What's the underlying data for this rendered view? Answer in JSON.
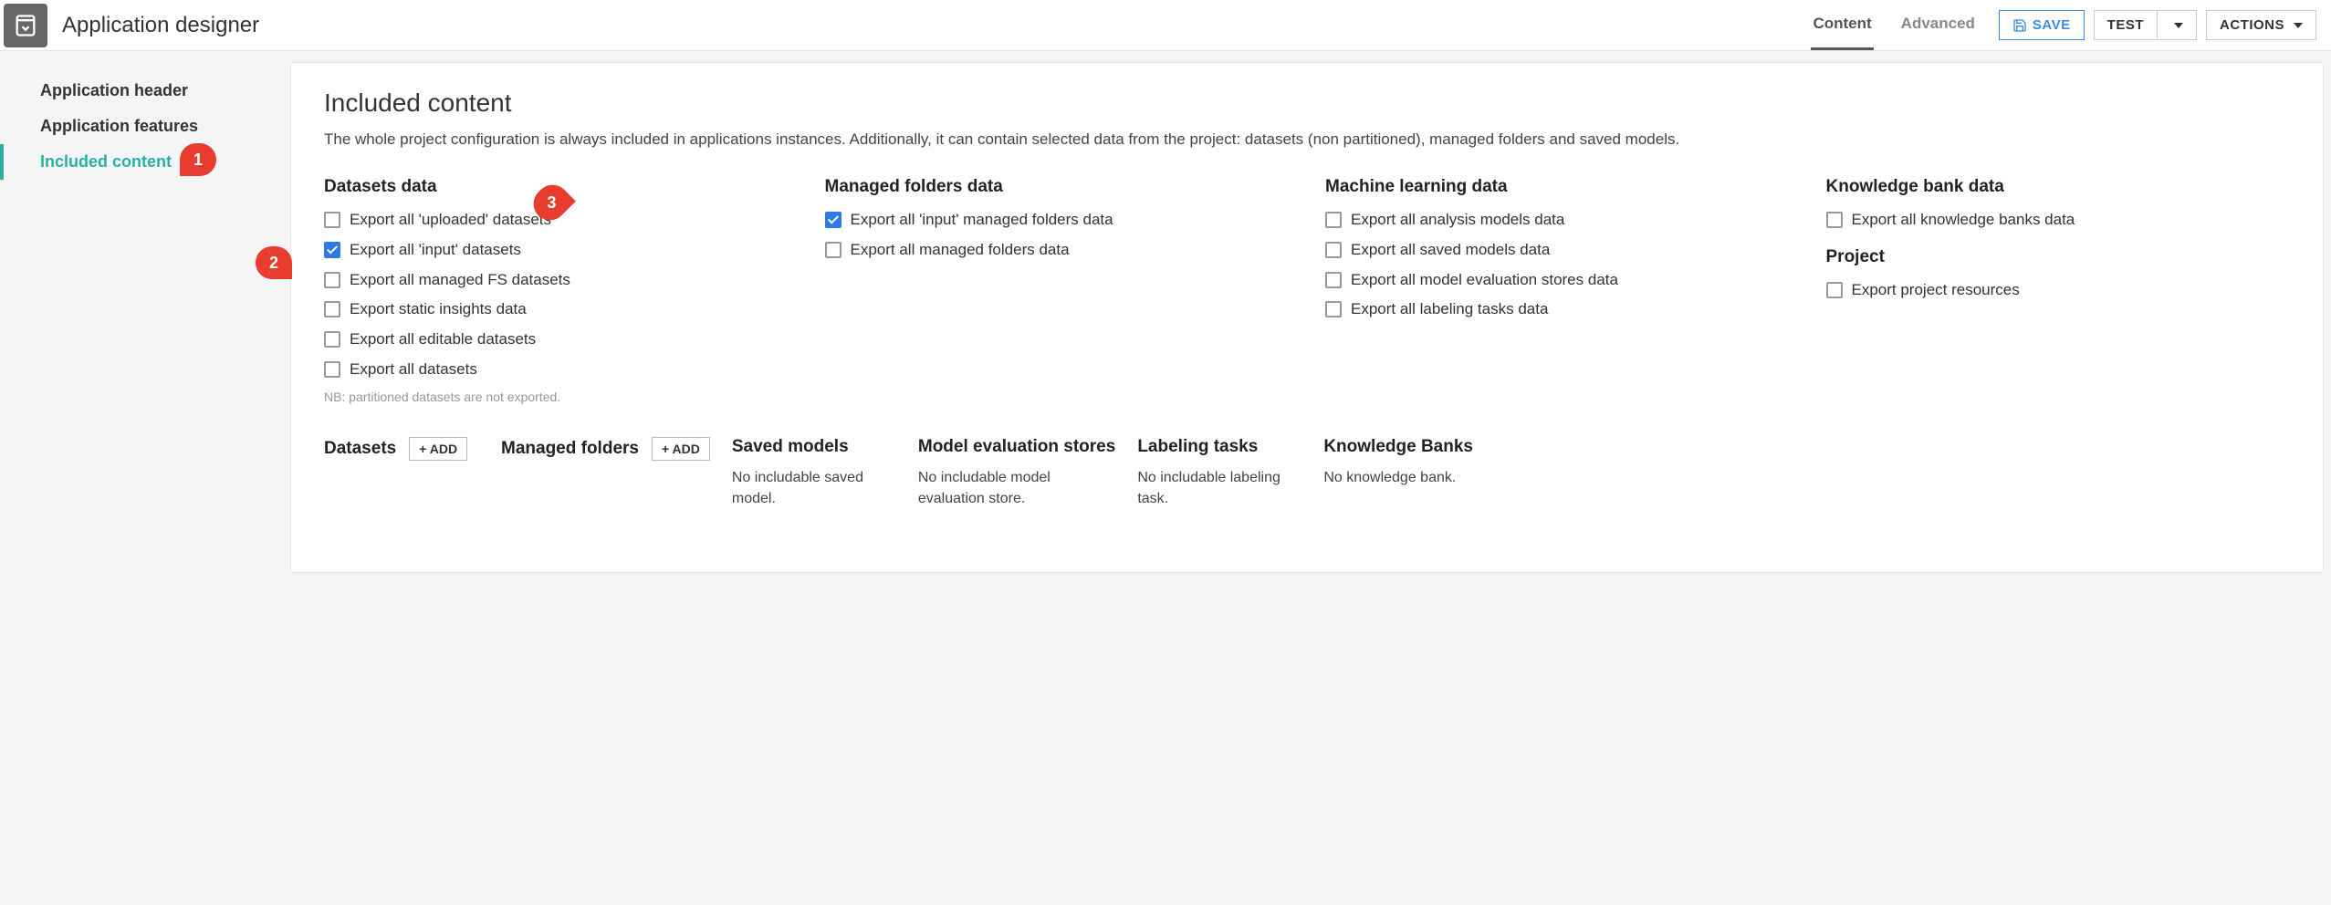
{
  "header": {
    "title": "Application designer",
    "tabs": {
      "content": "Content",
      "advanced": "Advanced"
    },
    "buttons": {
      "save": "SAVE",
      "test": "TEST",
      "actions": "ACTIONS"
    }
  },
  "sidebar": {
    "items": [
      {
        "label": "Application header"
      },
      {
        "label": "Application features"
      },
      {
        "label": "Included content"
      }
    ]
  },
  "main": {
    "title": "Included content",
    "desc": "The whole project configuration is always included in applications instances. Additionally, it can contain selected data from the project: datasets (non partitioned), managed folders and saved models.",
    "groups": {
      "datasets": {
        "title": "Datasets data",
        "items": [
          {
            "label": "Export all 'uploaded' datasets",
            "checked": false
          },
          {
            "label": "Export all 'input' datasets",
            "checked": true
          },
          {
            "label": "Export all managed FS datasets",
            "checked": false
          },
          {
            "label": "Export static insights data",
            "checked": false
          },
          {
            "label": "Export all editable datasets",
            "checked": false
          },
          {
            "label": "Export all datasets",
            "checked": false
          }
        ],
        "note": "NB: partitioned datasets are not exported."
      },
      "folders": {
        "title": "Managed folders data",
        "items": [
          {
            "label": "Export all 'input' managed folders data",
            "checked": true
          },
          {
            "label": "Export all managed folders data",
            "checked": false
          }
        ]
      },
      "ml": {
        "title": "Machine learning data",
        "items": [
          {
            "label": "Export all analysis models data",
            "checked": false
          },
          {
            "label": "Export all saved models data",
            "checked": false
          },
          {
            "label": "Export all model evaluation stores data",
            "checked": false
          },
          {
            "label": "Export all labeling tasks data",
            "checked": false
          }
        ]
      },
      "kb": {
        "title": "Knowledge bank data",
        "items": [
          {
            "label": "Export all knowledge banks data",
            "checked": false
          }
        ]
      },
      "project": {
        "title": "Project",
        "items": [
          {
            "label": "Export project resources",
            "checked": false
          }
        ]
      }
    },
    "sections": {
      "datasets": {
        "title": "Datasets",
        "add": "+ ADD"
      },
      "folders": {
        "title": "Managed folders",
        "add": "+ ADD"
      },
      "saved_models": {
        "title": "Saved models",
        "empty": "No includable saved model."
      },
      "mes": {
        "title": "Model evaluation stores",
        "empty": "No includable model evaluation store."
      },
      "labeling": {
        "title": "Labeling tasks",
        "empty": "No includable labeling task."
      },
      "kb": {
        "title": "Knowledge Banks",
        "empty": "No knowledge bank."
      }
    }
  },
  "annotations": {
    "m1": "1",
    "m2": "2",
    "m3": "3"
  }
}
